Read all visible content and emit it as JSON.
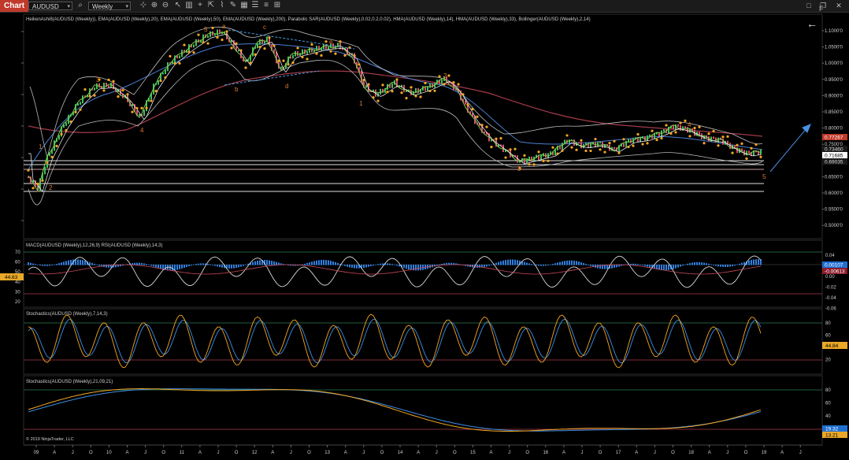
{
  "toolbar": {
    "tab": "Chart",
    "instrument": "AUDUSD",
    "period": "Weekly",
    "icons": [
      "search-icon",
      "crosshair-icon",
      "zoom-in-icon",
      "zoom-out-icon",
      "pointer-icon",
      "bar-chart-icon",
      "plus-icon",
      "cursor-icon",
      "ruler-icon",
      "pencil-icon",
      "grid-icon",
      "properties-icon",
      "list-icon",
      "layout-icon"
    ],
    "window_icons": [
      "maximize-icon",
      "restore-icon",
      "close-icon"
    ]
  },
  "price_panel": {
    "title": "HeikenAshi8(AUDUSD (Weekly)), EMA(AUDUSD (Weekly),20), EMA(AUDUSD (Weekly),50), EMA(AUDUSD (Weekly),200), Parabolic SAR(AUDUSD (Weekly),0.02,0.2,0.02), HMA(AUDUSD (Weekly),14), HMA(AUDUSD (Weekly),33), Bollinger(AUDUSD (Weekly),2,14)",
    "y_ticks": [
      "1.1000'0",
      "1.0500'0",
      "1.0000'0",
      "0.9500'0",
      "0.9000'0",
      "0.8500'0",
      "0.8000'0",
      "0.7500'0",
      "0.7000'0",
      "0.6500'0",
      "0.6000'0",
      "0.5500'0",
      "0.5000'0"
    ],
    "price_badges": [
      {
        "text": "0.77267",
        "bg": "#c0392b",
        "color": "#ffffff"
      },
      {
        "text": "0.73460",
        "bg": "#1a1a1a",
        "color": "#dddddd"
      },
      {
        "text": "0.71685",
        "bg": "#ffffff",
        "color": "#000000"
      },
      {
        "text": "0.69035",
        "bg": "#1a1a1a",
        "color": "#dddddd"
      }
    ],
    "wave_labels": [
      "5",
      "a",
      "c",
      "e",
      "3",
      "4",
      "b",
      "d",
      "1",
      "2",
      "1",
      "2",
      "3",
      "4",
      "5",
      "1",
      "2"
    ],
    "back_arrow": "←",
    "f_label": "F"
  },
  "macd_panel": {
    "title": "MACD(AUDUSD (Weekly),12,26,9)  RSI(AUDUSD (Weekly),14,3)",
    "left_ticks": [
      "70",
      "60",
      "50",
      "40",
      "30",
      "20"
    ],
    "right_ticks": [
      "0.04",
      "0.02",
      "0.00",
      "-0.02",
      "-0.04",
      "-0.06"
    ],
    "left_badge": "44.63",
    "right_badges": [
      {
        "text": "0.00107",
        "bg": "#1f6fd1"
      },
      {
        "text": "-0.00613",
        "bg": "#8e1b2b"
      }
    ]
  },
  "stoch1_panel": {
    "title": "Stochastics(AUDUSD (Weekly),7,14,3)",
    "right_ticks": [
      "80",
      "60",
      "40",
      "20"
    ],
    "badge": "44.84"
  },
  "stoch2_panel": {
    "title": "Stochastics(AUDUSD (Weekly),21,09,21)",
    "right_ticks": [
      "80",
      "60",
      "40",
      "20"
    ],
    "badges": [
      "19.32",
      "13.21"
    ],
    "copyright": "© 2019 NinjaTrader, LLC"
  },
  "x_axis": {
    "labels": [
      "09",
      "A",
      "J",
      "O",
      "10",
      "A",
      "J",
      "O",
      "11",
      "A",
      "J",
      "O",
      "12",
      "A",
      "J",
      "O",
      "13",
      "A",
      "J",
      "O",
      "14",
      "A",
      "J",
      "O",
      "15",
      "A",
      "J",
      "O",
      "16",
      "A",
      "J",
      "O",
      "17",
      "A",
      "J",
      "O",
      "18",
      "A",
      "J",
      "O",
      "19",
      "A",
      "J"
    ]
  },
  "colors": {
    "background": "#000000",
    "candle_up": "#3fbf5f",
    "candle_down": "#d94f6a",
    "sar": "#f5a623",
    "ema200": "#a23b4a",
    "ema50": "#4a7fd0",
    "bollinger": "#cccccc",
    "macd_hist": "#2f7fe0",
    "stoch_k": "#f5a623",
    "stoch_d": "#3b8fe6",
    "level_line": "#e8e8e8"
  }
}
